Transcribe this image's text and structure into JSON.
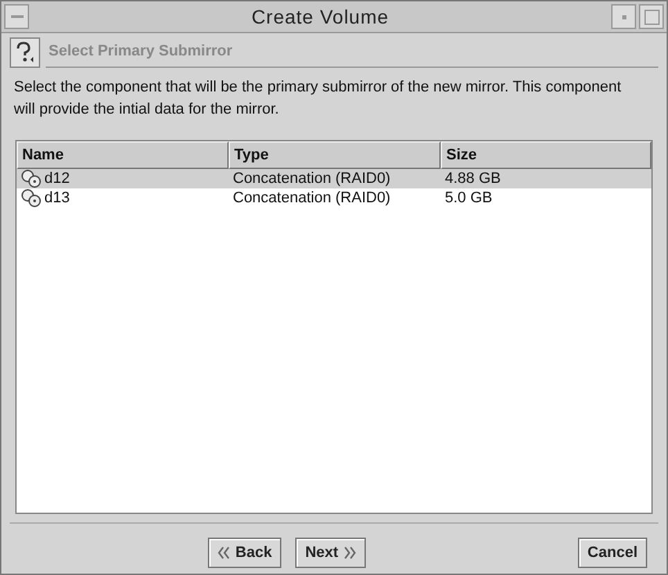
{
  "window": {
    "title": "Create Volume"
  },
  "header": {
    "title": "Select Primary Submirror"
  },
  "description": "Select the component that will be the primary submirror of the new mirror.  This component will provide the intial data for the mirror.",
  "table": {
    "columns": [
      "Name",
      "Type",
      "Size"
    ],
    "rows": [
      {
        "name": "d12",
        "type": "Concatenation (RAID0)",
        "size": "4.88 GB",
        "selected": true
      },
      {
        "name": "d13",
        "type": "Concatenation (RAID0)",
        "size": "5.0 GB",
        "selected": false
      }
    ]
  },
  "buttons": [
    {
      "label": "Back",
      "kind": "back"
    },
    {
      "label": "Next",
      "kind": "next"
    },
    {
      "label": "Cancel",
      "kind": "cancel"
    }
  ]
}
